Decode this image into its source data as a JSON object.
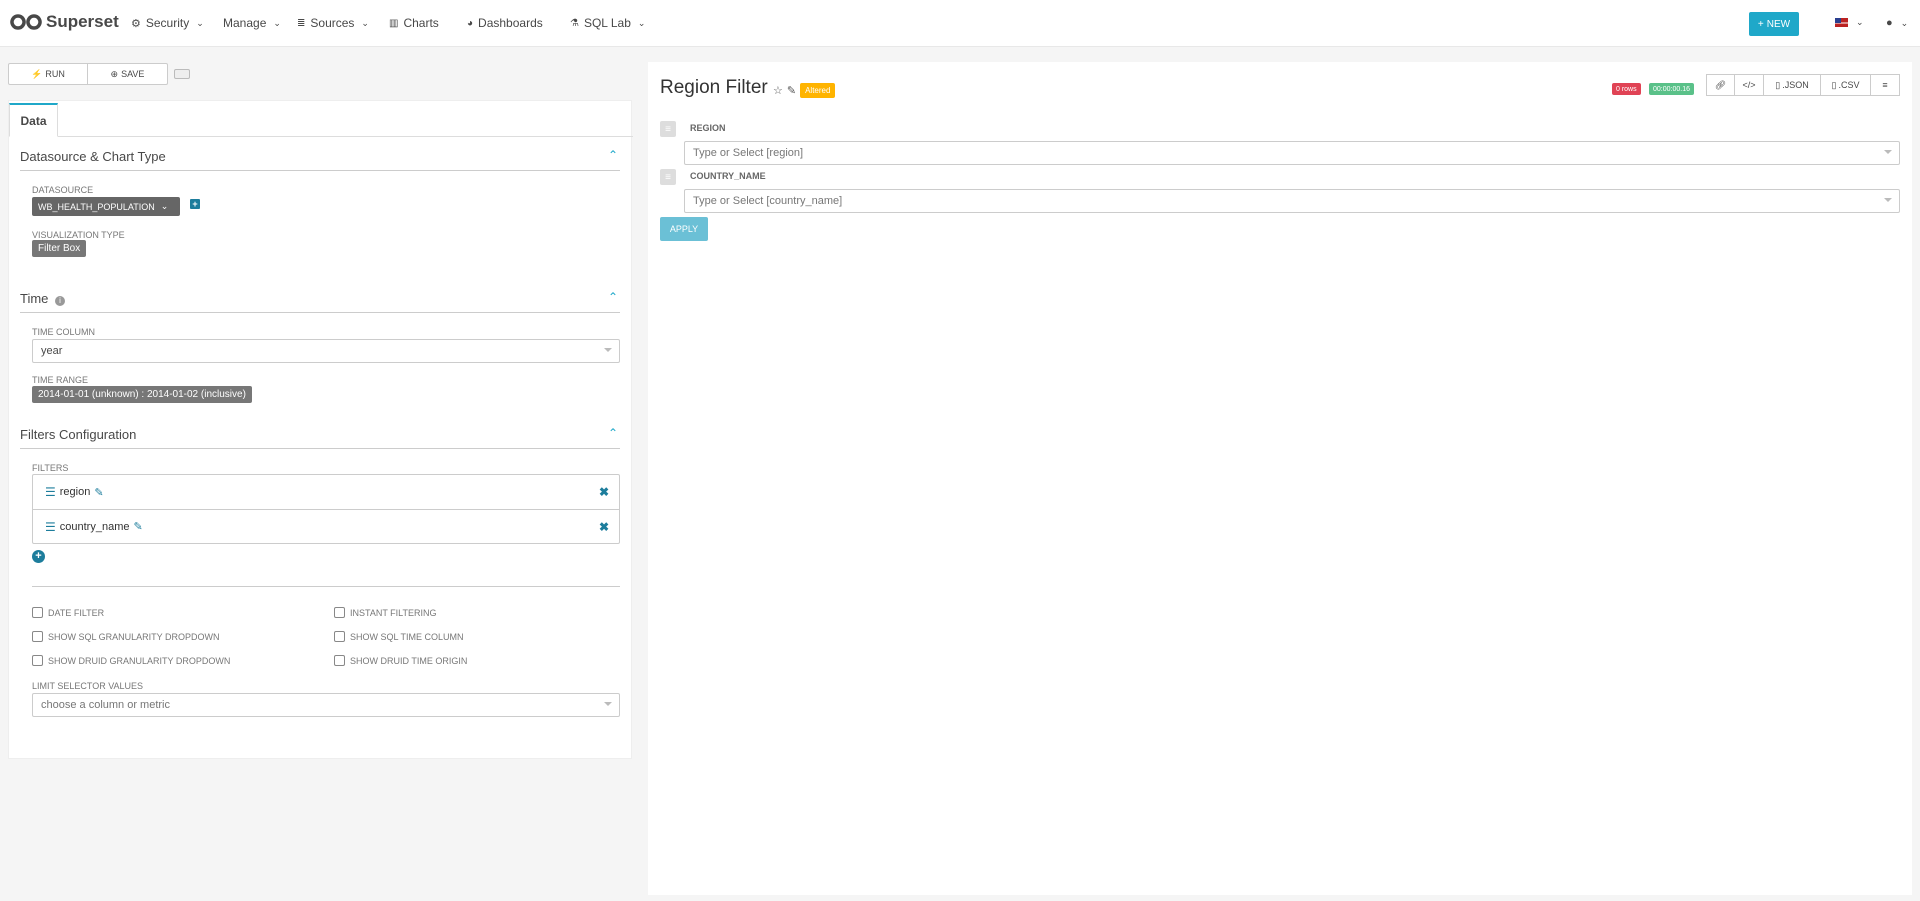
{
  "nav": {
    "brand": "Superset",
    "items": [
      {
        "label": "Security",
        "icon": "cogs-icon"
      },
      {
        "label": "Manage",
        "icon": ""
      },
      {
        "label": "Sources",
        "icon": "database-icon"
      },
      {
        "label": "Charts",
        "icon": "bar-chart-icon"
      },
      {
        "label": "Dashboards",
        "icon": "dashboard-icon"
      },
      {
        "label": "SQL Lab",
        "icon": "flask-icon"
      }
    ],
    "new_label": "NEW"
  },
  "toolbar": {
    "run_label": "RUN",
    "save_label": "SAVE"
  },
  "left": {
    "tab": "Data",
    "datasource_section": {
      "title": "Datasource & Chart Type",
      "datasource_label": "DATASOURCE",
      "datasource_value": "WB_HEALTH_POPULATION",
      "viz_label": "VISUALIZATION TYPE",
      "viz_value": "Filter Box"
    },
    "time_section": {
      "title": "Time",
      "time_column_label": "TIME COLUMN",
      "time_column_value": "year",
      "time_range_label": "TIME RANGE",
      "time_range_value": "2014-01-01 (unknown) : 2014-01-02 (inclusive)"
    },
    "filters_section": {
      "title": "Filters Configuration",
      "filters_label": "FILTERS",
      "filters": [
        "region",
        "country_name"
      ],
      "checkboxes": {
        "date_filter": "DATE FILTER",
        "instant_filtering": "INSTANT FILTERING",
        "show_sql_granularity": "SHOW SQL GRANULARITY DROPDOWN",
        "show_sql_time_column": "SHOW SQL TIME COLUMN",
        "show_druid_granularity": "SHOW DRUID GRANULARITY DROPDOWN",
        "show_druid_time_origin": "SHOW DRUID TIME ORIGIN"
      },
      "limit_label": "LIMIT SELECTOR VALUES",
      "limit_placeholder": "choose a column or metric"
    }
  },
  "right": {
    "title": "Region Filter",
    "altered": "Altered",
    "rows_badge": "0 rows",
    "time_badge": "00:00:00.16",
    "buttons": {
      "json": ".JSON",
      "csv": ".CSV"
    },
    "filter_boxes": [
      {
        "label": "REGION",
        "placeholder": "Type or Select [region]"
      },
      {
        "label": "COUNTRY_NAME",
        "placeholder": "Type or Select [country_name]"
      }
    ],
    "apply_label": "APPLY"
  },
  "colors": {
    "accent": "#1fa8c9",
    "danger": "#e04355",
    "success": "#5ac189",
    "warning": "#ffb400"
  }
}
